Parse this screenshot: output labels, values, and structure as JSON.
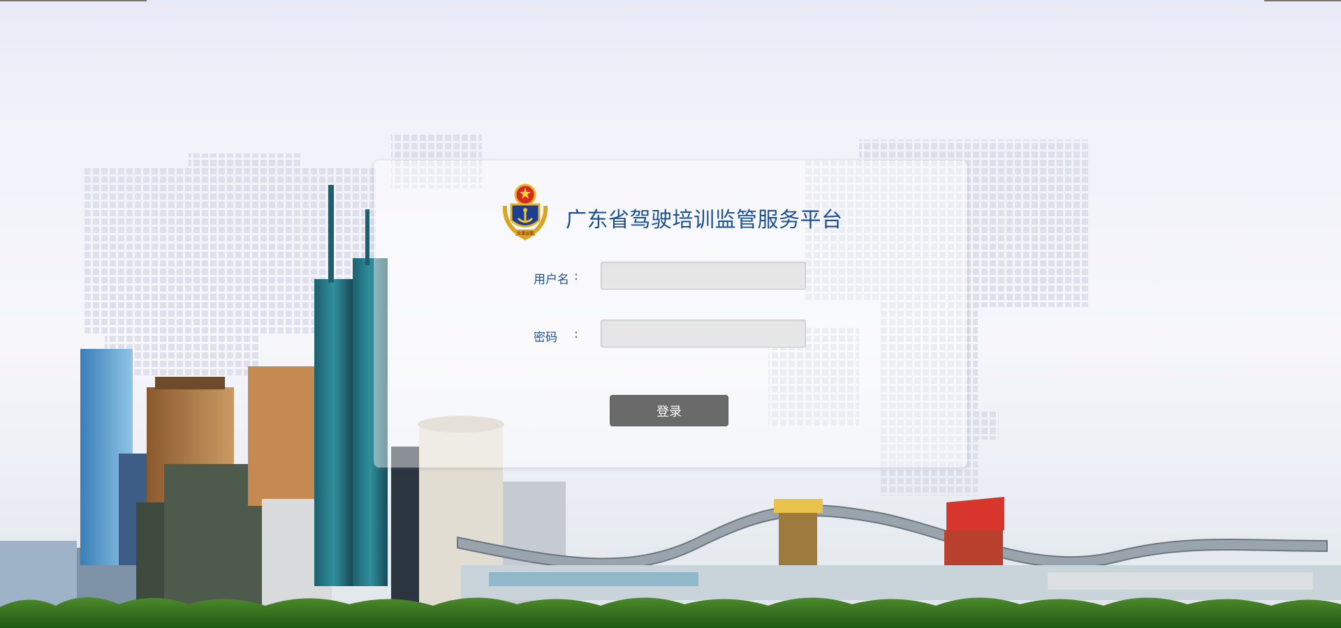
{
  "header": {
    "title": "广东省驾驶培训监管服务平台"
  },
  "logo": {
    "icon": "national-emblem-icon",
    "text": "交通运输"
  },
  "form": {
    "username_label": "用户名",
    "username_colon": ":",
    "username_value": "",
    "password_label": "密码",
    "password_colon": ":",
    "password_value": "",
    "login_label": "登录"
  },
  "colors": {
    "title": "#1c4f8f",
    "label": "#1f4e8a",
    "button": "#6a6a6a",
    "input_bg": "#e6e6e6"
  }
}
